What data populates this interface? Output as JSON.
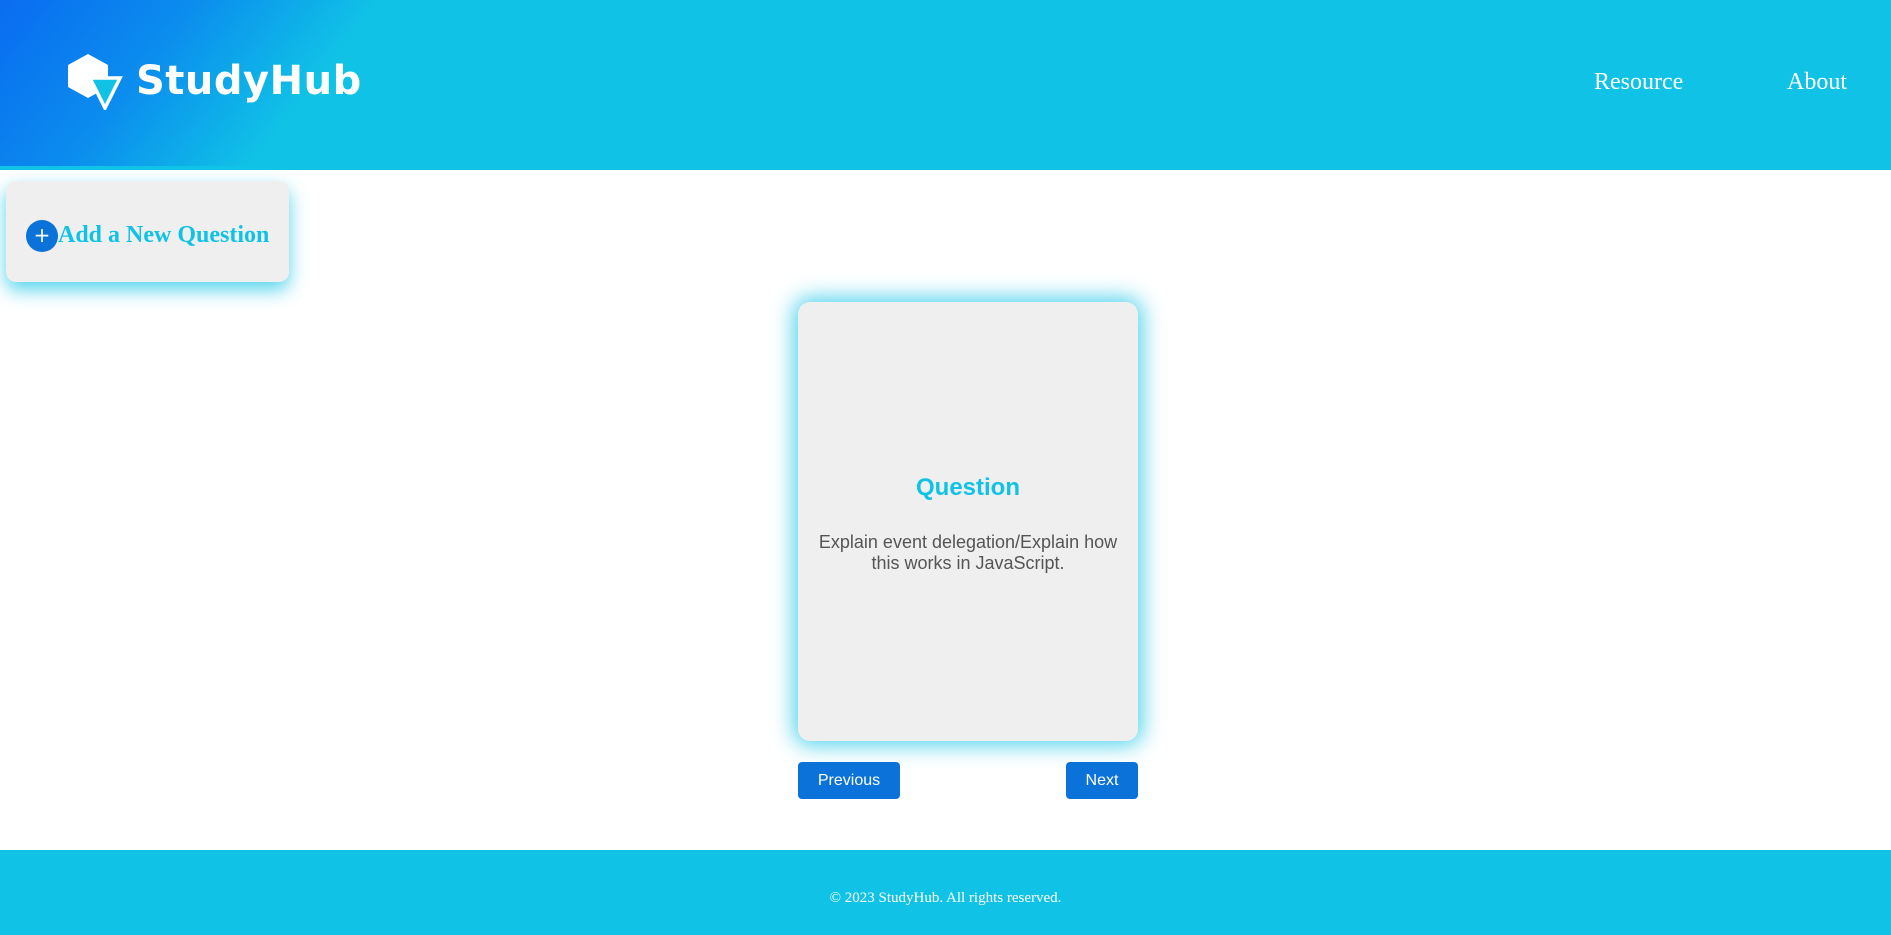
{
  "header": {
    "brand": "StudyHub",
    "logo_icon": "hexagon-triangle-logo-icon",
    "nav": [
      {
        "label": "Resource"
      },
      {
        "label": "About"
      }
    ]
  },
  "add_question": {
    "icon": "plus-icon",
    "plus_symbol": "+",
    "label": "Add a New Question"
  },
  "card": {
    "title": "Question",
    "text": "Explain event delegation/Explain how this works in JavaScript."
  },
  "controls": {
    "previous_label": "Previous",
    "next_label": "Next"
  },
  "footer": {
    "text": "© 2023 StudyHub. All rights reserved."
  },
  "colors": {
    "accent": "#10c3e6",
    "button": "#0a72d8",
    "card_bg": "#efefef"
  }
}
